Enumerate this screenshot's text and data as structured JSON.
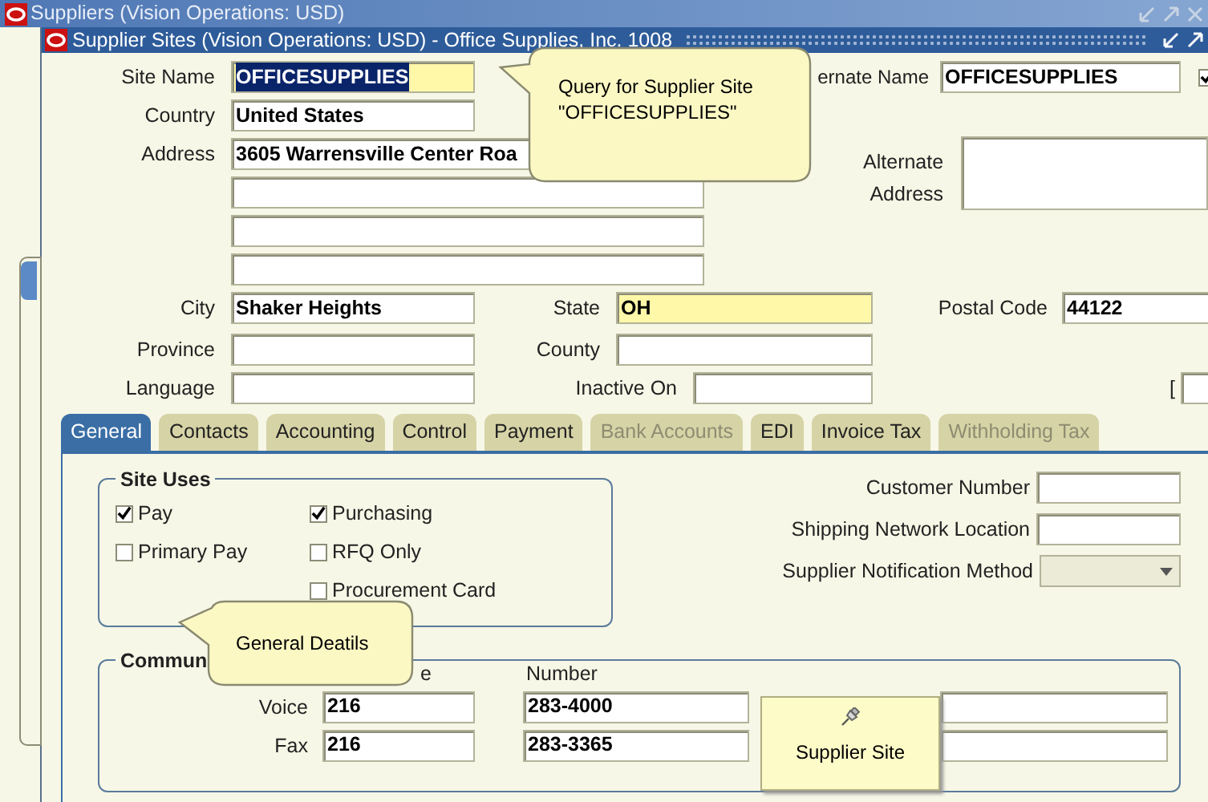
{
  "outer_window": {
    "title": "Suppliers (Vision Operations: USD)"
  },
  "window": {
    "title": "Supplier Sites (Vision Operations: USD) - Office Supplies, Inc. 1008"
  },
  "site_name": {
    "label": "Site Name",
    "value": "OFFICESUPPLIES",
    "highlighted": true
  },
  "alternate_name": {
    "label": "ernate Name",
    "value": "OFFICESUPPLIES",
    "checked": true
  },
  "country": {
    "label": "Country",
    "value": "United States"
  },
  "address": {
    "label": "Address",
    "value": "3605 Warrensville Center Roa"
  },
  "alternate_address": {
    "label": "Alternate Address"
  },
  "city": {
    "label": "City",
    "value": "Shaker Heights"
  },
  "state": {
    "label": "State",
    "value": "OH"
  },
  "postal_code": {
    "label": "Postal Code",
    "value": "44122"
  },
  "province": {
    "label": "Province"
  },
  "county": {
    "label": "County"
  },
  "language": {
    "label": "Language"
  },
  "inactive_on": {
    "label": "Inactive On"
  },
  "bracket": "[",
  "tabs": [
    {
      "label": "General",
      "selected": true,
      "disabled": false
    },
    {
      "label": "Contacts",
      "selected": false,
      "disabled": false
    },
    {
      "label": "Accounting",
      "selected": false,
      "disabled": false
    },
    {
      "label": "Control",
      "selected": false,
      "disabled": false
    },
    {
      "label": "Payment",
      "selected": false,
      "disabled": false
    },
    {
      "label": "Bank Accounts",
      "selected": false,
      "disabled": true
    },
    {
      "label": "EDI",
      "selected": false,
      "disabled": false
    },
    {
      "label": "Invoice Tax",
      "selected": false,
      "disabled": false
    },
    {
      "label": "Withholding Tax",
      "selected": false,
      "disabled": true
    }
  ],
  "site_uses": {
    "title": "Site Uses",
    "column_1": [
      {
        "label": "Pay",
        "checked": true
      },
      {
        "label": "Primary Pay",
        "checked": false
      }
    ],
    "column_2": [
      {
        "label": "Purchasing",
        "checked": true
      },
      {
        "label": "RFQ Only",
        "checked": false
      },
      {
        "label": "Procurement Card",
        "checked": false
      }
    ]
  },
  "side_fields": [
    {
      "label": "Customer Number",
      "kind": "text"
    },
    {
      "label": "Shipping Network Location",
      "kind": "text"
    },
    {
      "label": "Supplier Notification Method",
      "kind": "dropdown"
    }
  ],
  "communication": {
    "title": "Commun",
    "column_1": "e",
    "column_2": "Number",
    "rows": [
      {
        "label": "Voice",
        "area": "216",
        "number": "283-4000"
      },
      {
        "label": "Fax",
        "area": "216",
        "number": "283-3365"
      }
    ]
  },
  "callouts": [
    {
      "kind": "query",
      "text": "Query for Supplier Site\n\"OFFICESUPPLIES\""
    },
    {
      "kind": "general",
      "text": "General Deatils"
    }
  ],
  "note": {
    "text": "Supplier Site"
  }
}
